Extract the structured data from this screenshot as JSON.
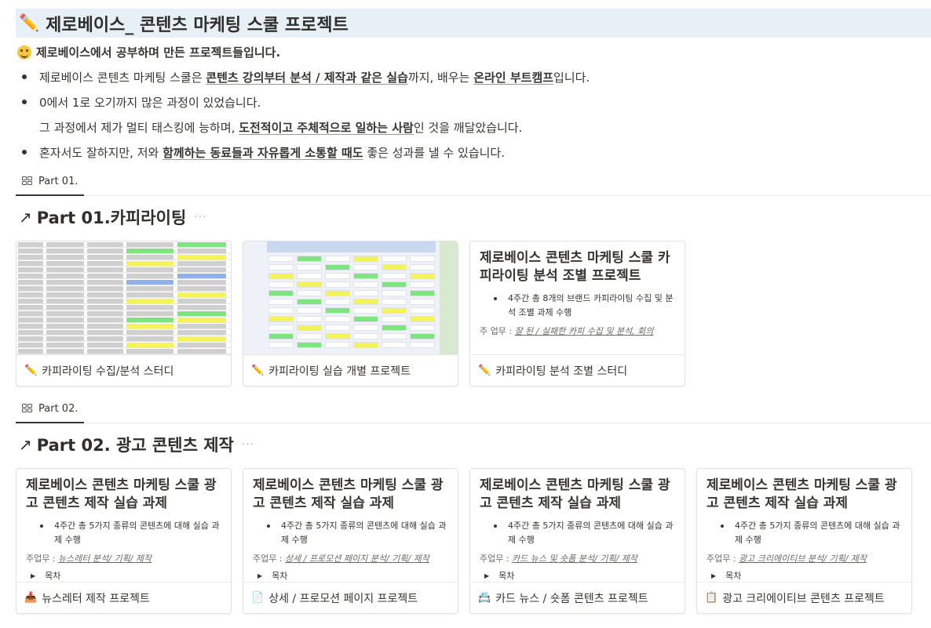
{
  "page": {
    "title_icon": "pencil-icon",
    "title": "제로베이스_ 콘텐츠 마케팅 스쿨 프로젝트",
    "intro_icon": "grinning-face-icon",
    "intro": "제로베이스에서 공부하며 만든 프로젝트들입니다."
  },
  "bullets": [
    {
      "pre": "제로베이스 콘텐츠 마케팅 스쿨은 ",
      "bold1": "콘텐츠 강의부터 분석 / 제작과 같은 실습",
      "mid": "까지, 배우는 ",
      "bold2": "온라인 부트캠프",
      "post": "입니다."
    },
    {
      "pre": "0에서 1로 오기까지 많은 과정이 있었습니다."
    },
    {
      "line2_pre": "그 과정에서 제가 멀티 태스킹에 능하며, ",
      "line2_bold": "도전적이고 주체적으로 일하는 사람",
      "line2_post": "인 것을 깨달았습니다."
    },
    {
      "pre": "혼자서도 잘하지만, 저와 ",
      "bold1": "함께하는 동료들과 자유롭게 소통할 때도",
      "post": " 좋은 성과를 낼 수 있습니다."
    }
  ],
  "part1": {
    "tab": "Part 01.",
    "heading": "Part 01.카피라이팅",
    "cards": [
      {
        "icon": "pencil-icon",
        "label": "카피라이팅 수집/분석 스터디"
      },
      {
        "icon": "pencil-icon",
        "label": "카피라이팅 실습 개별 프로젝트"
      },
      {
        "icon": "pencil-icon",
        "label": "카피라이팅 분석 조별 스터디",
        "preview_title": "제로베이스 콘텐츠 마케팅 스쿨 카피라이팅 분석 조별 프로젝트",
        "preview_bullet": "4주간 총 8개의 브랜드 카피라이팅 수집 및 분석 조별 과제 수행",
        "preview_duty_label": "주 업무 : ",
        "preview_duty": "잘 된 / 실패한 카피 수집 및 분석, 회의"
      }
    ]
  },
  "part2": {
    "tab": "Part 02.",
    "heading": "Part 02. 광고 콘텐츠 제작",
    "cards": [
      {
        "icon": "inbox-tray-icon",
        "label": "뉴스레터 제작 프로젝트",
        "preview_title": "제로베이스 콘텐츠 마케팅 스쿨 광고 콘텐츠 제작 실습 과제",
        "preview_bullet": "4주간 총 5가지 종류의 콘텐츠에 대해 실습 과제 수행",
        "duty_label": "주업무 : ",
        "duty": "뉴스레터 분석/ 기획/ 제작",
        "toggle": "목차"
      },
      {
        "icon": "page-icon",
        "label": "상세 / 프로모션 페이지 프로젝트",
        "preview_title": "제로베이스 콘텐츠 마케팅 스쿨 광고 콘텐츠 제작 실습 과제",
        "preview_bullet": "4주간 총 5가지 종류의 콘텐츠에 대해 실습 과제 수행",
        "duty_label": "주업무 : ",
        "duty": "상세 / 프로모션 페이지 분석/ 기획/ 제작",
        "toggle": "목차"
      },
      {
        "icon": "card-index-icon",
        "label": "카드 뉴스 / 숏폼 콘텐츠 프로젝트",
        "preview_title": "제로베이스 콘텐츠 마케팅 스쿨 광고 콘텐츠 제작 실습 과제",
        "preview_bullet": "4주간 총 5가지 종류의 콘텐츠에 대해 실습 과제 수행",
        "duty_label": "주업무 : ",
        "duty": "카드 뉴스 및 숏폼 분석/ 기획/ 제작",
        "toggle": "목차"
      },
      {
        "icon": "clipboard-icon",
        "label": "광고 크리에이티브 콘텐츠 프로젝트",
        "preview_title": "제로베이스 콘텐츠 마케팅 스쿨 광고 콘텐츠 제작 실습 과제",
        "preview_bullet": "4주간 총 5가지 종류의 콘텐츠에 대해 실습 과제 수행",
        "duty_label": "주업무 : ",
        "duty": "광고 크리에이티브 분석/ 기획/ 제작",
        "toggle": "목차"
      }
    ]
  },
  "colors": {
    "title_bg": "#e7f0f7",
    "text": "#37352f",
    "sheet_yellow": "#f4f35b",
    "sheet_green": "#7fe37f"
  }
}
